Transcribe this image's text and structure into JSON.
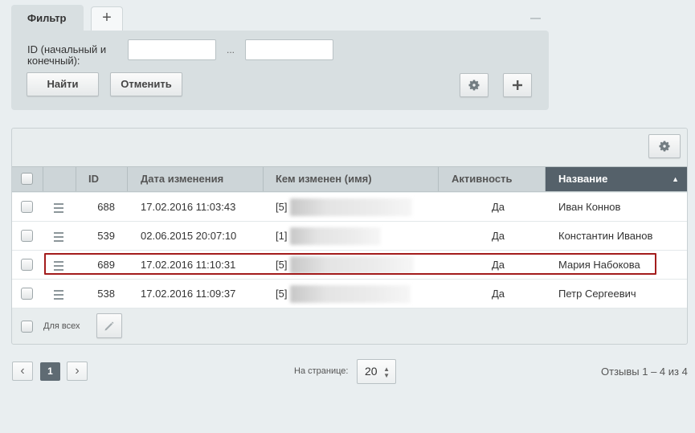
{
  "filter": {
    "tab_label": "Фильтр",
    "add_tab_symbol": "+",
    "field_label": "ID (начальный и конечный):",
    "range_from_value": "",
    "range_to_value": "",
    "range_separator": "...",
    "find_label": "Найти",
    "cancel_label": "Отменить"
  },
  "grid": {
    "columns": [
      {
        "label": ""
      },
      {
        "label": ""
      },
      {
        "label": "ID"
      },
      {
        "label": "Дата изменения"
      },
      {
        "label": "Кем изменен (имя)"
      },
      {
        "label": "Активность"
      },
      {
        "label": "Название"
      }
    ],
    "sorted_column": "Название",
    "sort_direction": "asc",
    "rows": [
      {
        "id": "688",
        "date": "17.02.2016 11:03:43",
        "changed_by_prefix": "[5]",
        "active": "Да",
        "name": "Иван Коннов"
      },
      {
        "id": "539",
        "date": "02.06.2015 20:07:10",
        "changed_by_prefix": "[1]",
        "active": "Да",
        "name": "Константин Иванов"
      },
      {
        "id": "689",
        "date": "17.02.2016 11:10:31",
        "changed_by_prefix": "[5]",
        "active": "Да",
        "name": "Мария Набокова"
      },
      {
        "id": "538",
        "date": "17.02.2016 11:09:37",
        "changed_by_prefix": "[5]",
        "active": "Да",
        "name": "Петр Сергеевич"
      }
    ],
    "highlighted_row_index": 2,
    "footer_for_all_label": "Для всех"
  },
  "pagination": {
    "prev_symbol": "‹",
    "current_page": "1",
    "next_symbol": "›",
    "per_page_label": "На странице:",
    "per_page_value": "20",
    "summary": "Отзывы 1 – 4 из 4"
  },
  "colors": {
    "sorted_header_bg": "#55616a",
    "highlight_border": "#a31c1c",
    "current_page_bg": "#5f6b73"
  }
}
